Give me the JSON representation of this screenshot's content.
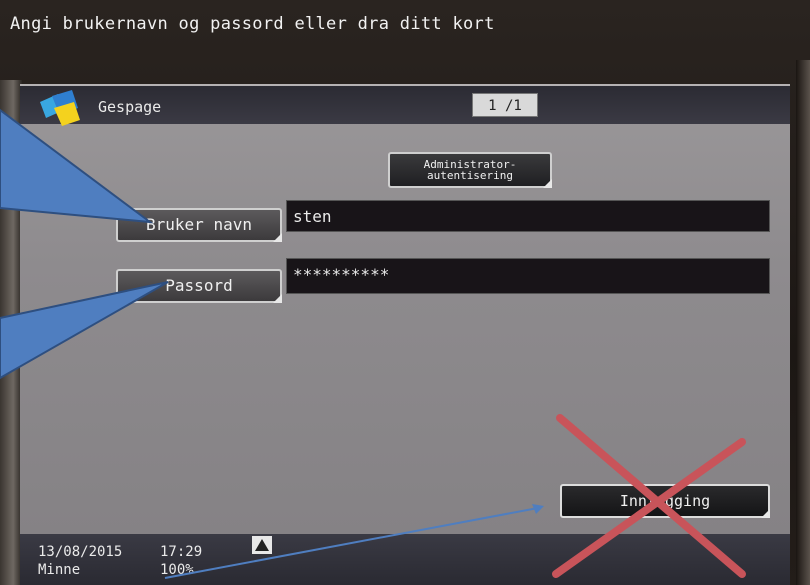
{
  "prompt": "Angi brukernavn og passord eller dra ditt kort",
  "header": {
    "app_name": "Gespage",
    "page_indicator": "1 /1",
    "logo_icon": "gespage-logo-icon"
  },
  "admin_button": {
    "line1": "Administrator-",
    "line2": "autentisering"
  },
  "username": {
    "button_label": "Bruker navn",
    "value": "sten"
  },
  "password": {
    "button_label": "Passord",
    "value": "**********"
  },
  "login_button": {
    "label": "Innlogging"
  },
  "status": {
    "date": "13/08/2015",
    "time": "17:29",
    "memory_label": "Minne",
    "memory_value": "100%",
    "warning_icon": "warning-triangle-icon"
  },
  "annotations": {
    "arrow_color": "#4f7ec0",
    "cross_color": "#c8545a"
  }
}
